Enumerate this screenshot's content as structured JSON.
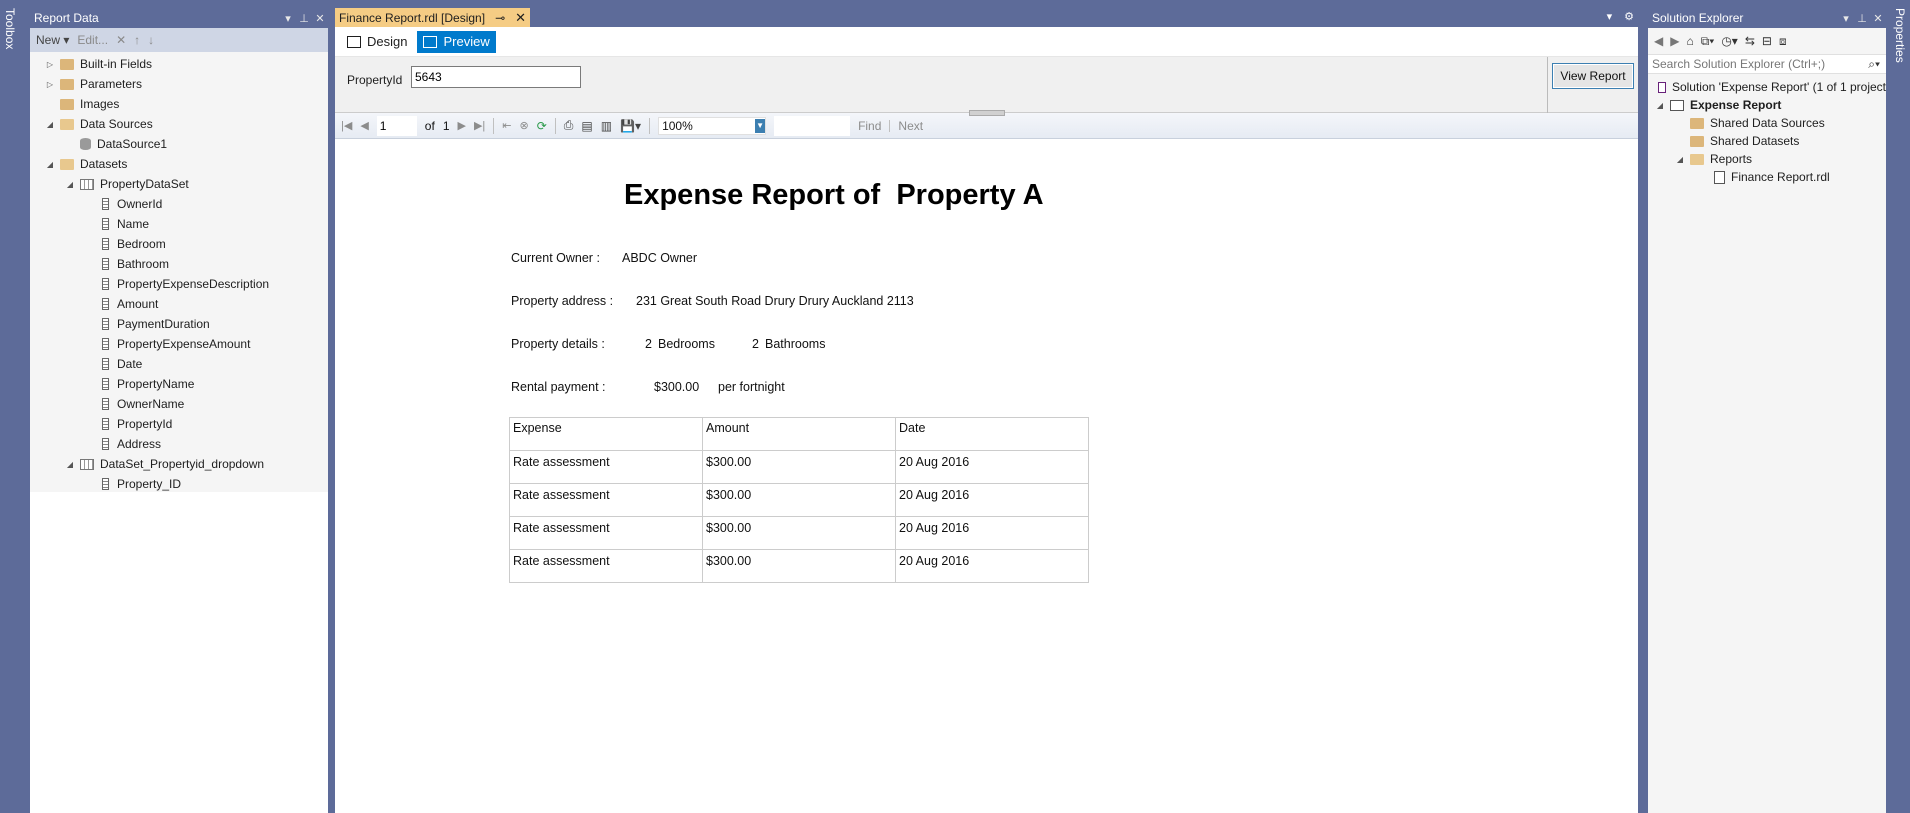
{
  "side_strips": {
    "left": "Toolbox",
    "right": "Properties"
  },
  "report_data": {
    "title": "Report Data",
    "toolbar": {
      "new_label": "New ▾",
      "edit_label": "Edit..."
    },
    "tree": {
      "builtin_fields": "Built-in Fields",
      "parameters": "Parameters",
      "images": "Images",
      "data_sources": "Data Sources",
      "datasource1": "DataSource1",
      "datasets": "Datasets",
      "property_dataset": "PropertyDataSet",
      "fields": [
        "OwnerId",
        "Name",
        "Bedroom",
        "Bathroom",
        "PropertyExpenseDescription",
        "Amount",
        "PaymentDuration",
        "PropertyExpenseAmount",
        "Date",
        "PropertyName",
        "OwnerName",
        "PropertyId",
        "Address"
      ],
      "dropdown_dataset": "DataSet_Propertyid_dropdown",
      "dropdown_field": "Property_ID"
    }
  },
  "document": {
    "tab_title": "Finance Report.rdl [Design]",
    "design_tab": "Design",
    "preview_tab": "Preview",
    "param_label": "PropertyId",
    "param_value": "5643",
    "view_report_label": "View Report",
    "toolbar": {
      "page_value": "1",
      "of_label": "of",
      "total_pages": "1",
      "zoom": "100%",
      "find_label": "Find",
      "next_label": "Next"
    }
  },
  "report": {
    "title": "Expense Report of  Property A",
    "owner_label": "Current Owner :",
    "owner_value": "ABDC Owner",
    "address_label": "Property address :",
    "address_value": "231 Great South Road Drury Drury Auckland 2113",
    "details_label": "Property details :",
    "bedrooms_count": "2",
    "bedrooms_label": "Bedrooms",
    "bathrooms_count": "2",
    "bathrooms_label": "Bathrooms",
    "rental_label": "Rental payment :",
    "rental_amount": "$300.00",
    "rental_period": "per fortnight",
    "table": {
      "headers": [
        "Expense",
        "Amount",
        "Date"
      ],
      "rows": [
        [
          "Rate assessment",
          "$300.00",
          "20 Aug 2016"
        ],
        [
          "Rate assessment",
          "$300.00",
          "20 Aug 2016"
        ],
        [
          "Rate assessment",
          "$300.00",
          "20 Aug 2016"
        ],
        [
          "Rate assessment",
          "$300.00",
          "20 Aug 2016"
        ]
      ]
    }
  },
  "solution_explorer": {
    "title": "Solution Explorer",
    "search_placeholder": "Search Solution Explorer (Ctrl+;)",
    "solution": "Solution 'Expense Report' (1 of 1 project",
    "project": "Expense Report",
    "shared_data_sources": "Shared Data Sources",
    "shared_datasets": "Shared Datasets",
    "reports": "Reports",
    "report_file": "Finance Report.rdl"
  }
}
